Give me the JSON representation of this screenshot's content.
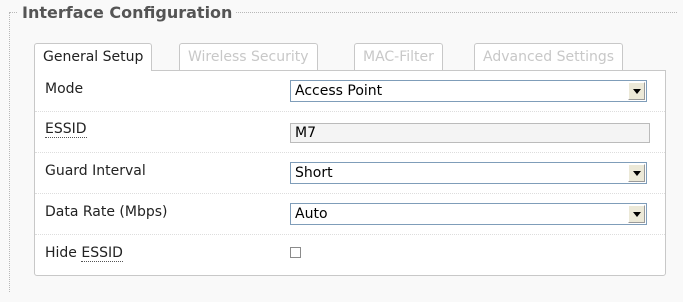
{
  "section": {
    "title": "Interface Configuration"
  },
  "tabs": [
    {
      "label": "General Setup",
      "active": true
    },
    {
      "label": "Wireless Security",
      "active": false
    },
    {
      "label": "MAC-Filter",
      "active": false
    },
    {
      "label": "Advanced Settings",
      "active": false
    }
  ],
  "fields": {
    "mode": {
      "label": "Mode",
      "value": "Access Point"
    },
    "essid": {
      "label": "ESSID",
      "value": "M7"
    },
    "guard_interval": {
      "label": "Guard Interval",
      "value": "Short"
    },
    "data_rate": {
      "label": "Data Rate (Mbps)",
      "value": "Auto"
    },
    "hide_essid": {
      "label_prefix": "Hide ",
      "label_abbr": "ESSID",
      "checked": false
    }
  }
}
